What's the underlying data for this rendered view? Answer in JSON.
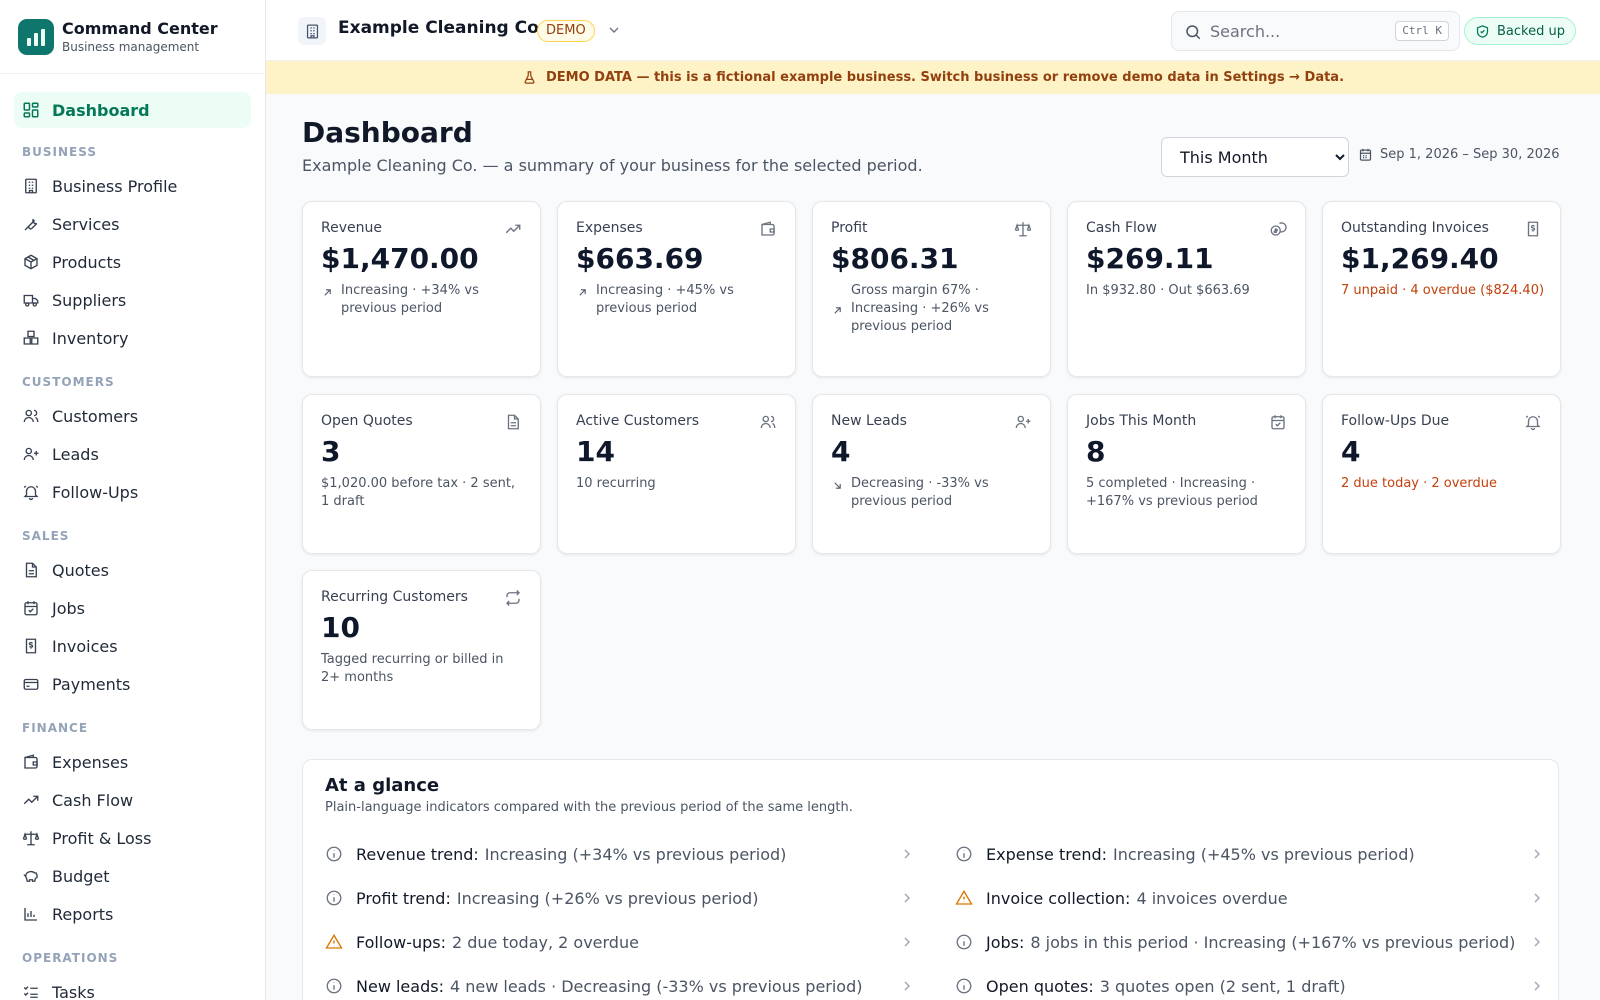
{
  "brand": {
    "title": "Command Center",
    "subtitle": "Business management"
  },
  "nav": {
    "dashboard": "Dashboard",
    "sections": {
      "business": "BUSINESS",
      "customers": "CUSTOMERS",
      "sales": "SALES",
      "finance": "FINANCE",
      "operations": "OPERATIONS"
    },
    "items": {
      "business_profile": "Business Profile",
      "services": "Services",
      "products": "Products",
      "suppliers": "Suppliers",
      "inventory": "Inventory",
      "customers": "Customers",
      "leads": "Leads",
      "follow_ups": "Follow-Ups",
      "quotes": "Quotes",
      "jobs": "Jobs",
      "invoices": "Invoices",
      "payments": "Payments",
      "expenses": "Expenses",
      "cash_flow": "Cash Flow",
      "profit_loss": "Profit & Loss",
      "budget": "Budget",
      "reports": "Reports",
      "tasks": "Tasks"
    }
  },
  "topbar": {
    "business_name": "Example Cleaning Co.",
    "demo_badge": "DEMO",
    "search_placeholder": "Search...",
    "search_shortcut": "Ctrl K",
    "backup_status": "Backed up"
  },
  "banner": "DEMO DATA — this is a fictional example business. Switch business or remove demo data in Settings → Data.",
  "page": {
    "title": "Dashboard",
    "subtitle": "Example Cleaning Co. — a summary of your business for the selected period.",
    "period": "This Month",
    "date_range": "Sep 1, 2026 – Sep 30, 2026"
  },
  "cards": {
    "revenue": {
      "label": "Revenue",
      "value": "$1,470.00",
      "detail": "Increasing · +34% vs previous period"
    },
    "expenses": {
      "label": "Expenses",
      "value": "$663.69",
      "detail": "Increasing · +45% vs previous period"
    },
    "profit": {
      "label": "Profit",
      "value": "$806.31",
      "detail": "Gross margin 67% · Increasing · +26% vs previous period"
    },
    "cash_flow": {
      "label": "Cash Flow",
      "value": "$269.11",
      "detail": "In $932.80 · Out $663.69"
    },
    "outstanding": {
      "label": "Outstanding Invoices",
      "value": "$1,269.40",
      "detail": "7 unpaid · 4 overdue ($824.40)"
    },
    "open_quotes": {
      "label": "Open Quotes",
      "value": "3",
      "detail": "$1,020.00 before tax · 2 sent, 1 draft"
    },
    "active_customers": {
      "label": "Active Customers",
      "value": "14",
      "detail": "10 recurring"
    },
    "new_leads": {
      "label": "New Leads",
      "value": "4",
      "detail": "Decreasing · -33% vs previous period"
    },
    "jobs_month": {
      "label": "Jobs This Month",
      "value": "8",
      "detail": "5 completed · Increasing · +167% vs previous period"
    },
    "follow_ups": {
      "label": "Follow-Ups Due",
      "value": "4",
      "detail": "2 due today · 2 overdue"
    },
    "recurring": {
      "label": "Recurring Customers",
      "value": "10",
      "detail": "Tagged recurring or billed in 2+ months"
    }
  },
  "glance": {
    "title": "At a glance",
    "subtitle": "Plain-language indicators compared with the previous period of the same length.",
    "rows": [
      {
        "label": "Revenue trend:",
        "text": "Increasing (+34% vs previous period)"
      },
      {
        "label": "Expense trend:",
        "text": "Increasing (+45% vs previous period)"
      },
      {
        "label": "Profit trend:",
        "text": "Increasing (+26% vs previous period)"
      },
      {
        "label": "Invoice collection:",
        "text": "4 invoices overdue"
      },
      {
        "label": "Follow-ups:",
        "text": "2 due today, 2 overdue"
      },
      {
        "label": "Jobs:",
        "text": "8 jobs in this period · Increasing (+167% vs previous period)"
      },
      {
        "label": "New leads:",
        "text": "4 new leads · Decreasing (-33% vs previous period)"
      },
      {
        "label": "Open quotes:",
        "text": "3 quotes open (2 sent, 1 draft)"
      }
    ]
  },
  "colors": {
    "accent": "#047857",
    "accent_bg": "#ecfdf5",
    "warning": "#c2410c",
    "banner_bg": "#fef3c7",
    "banner_text": "#92400e"
  }
}
